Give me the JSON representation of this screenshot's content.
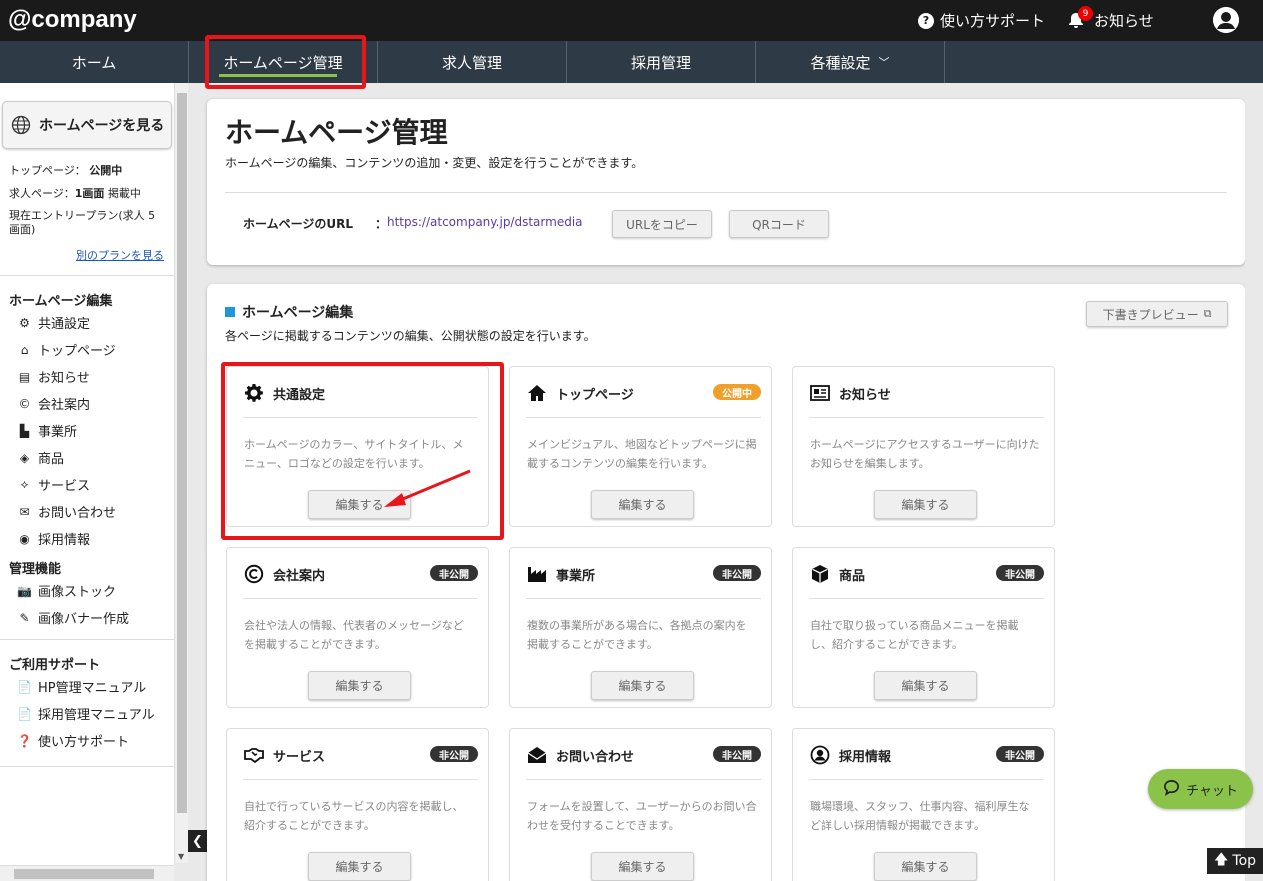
{
  "app": {
    "logo": "@company"
  },
  "header": {
    "help_label": "使い方サポート",
    "notice_label": "お知らせ",
    "notice_count": "9"
  },
  "nav": {
    "items": [
      {
        "label": "ホーム"
      },
      {
        "label": "ホームページ管理",
        "active": true
      },
      {
        "label": "求人管理"
      },
      {
        "label": "採用管理"
      },
      {
        "label": "各種設定",
        "dropdown": true
      }
    ]
  },
  "sidebar": {
    "view_hp_label": "ホームページを見る",
    "plan": {
      "top_label": "トップページ：",
      "top_value": "公開中",
      "job_label": "求人ページ：",
      "job_value": "1画面",
      "job_suffix": " 掲載中",
      "current_plan": "現在エントリープラン(求人 5画面)",
      "other_plan_link": "別のプランを見る"
    },
    "section_edit": "ホームページ編集",
    "edit_items": [
      "共通設定",
      "トップページ",
      "お知らせ",
      "会社案内",
      "事業所",
      "商品",
      "サービス",
      "お問い合わせ",
      "採用情報"
    ],
    "section_admin": "管理機能",
    "admin_items": [
      "画像ストック",
      "画像バナー作成"
    ],
    "section_support": "ご利用サポート",
    "support_items": [
      "HP管理マニュアル",
      "採用管理マニュアル",
      "使い方サポート"
    ]
  },
  "main": {
    "title": "ホームページ管理",
    "description": "ホームページの編集、コンテンツの追加・変更、設定を行うことができます。",
    "url_label": "ホームページのURL",
    "url_colon": "：",
    "url_value": "https://atcompany.jp/dstarmedia",
    "copy_button": "URLをコピー",
    "qr_button": "QRコード"
  },
  "edit_section": {
    "title": "ホームページ編集",
    "description": "各ページに掲載するコンテンツの編集、公開状態の設定を行います。",
    "preview_button": "下書きプレビュー",
    "cards": [
      {
        "icon": "gear-icon",
        "title": "共通設定",
        "badge": "",
        "desc": "ホームページのカラー、サイトタイトル、メニュー、ロゴなどの設定を行います。",
        "button": "編集する"
      },
      {
        "icon": "home-icon",
        "title": "トップページ",
        "badge": "公開中",
        "desc": "メインビジュアル、地図などトップページに掲載するコンテンツの編集を行います。",
        "button": "編集する"
      },
      {
        "icon": "newspaper-icon",
        "title": "お知らせ",
        "badge": "",
        "desc": "ホームページにアクセスするユーザーに向けたお知らせを編集します。",
        "button": "編集する"
      },
      {
        "icon": "copyright-icon",
        "title": "会社案内",
        "badge": "非公開",
        "desc": "会社や法人の情報、代表者のメッセージなどを掲載することができます。",
        "button": "編集する"
      },
      {
        "icon": "factory-icon",
        "title": "事業所",
        "badge": "非公開",
        "desc": "複数の事業所がある場合に、各拠点の案内を掲載することができます。",
        "button": "編集する"
      },
      {
        "icon": "box-icon",
        "title": "商品",
        "badge": "非公開",
        "desc": "自社で取り扱っている商品メニューを掲載し、紹介することができます。",
        "button": "編集する"
      },
      {
        "icon": "handshake-icon",
        "title": "サービス",
        "badge": "非公開",
        "desc": "自社で行っているサービスの内容を掲載し、紹介することができます。",
        "button": "編集する"
      },
      {
        "icon": "envelope-icon",
        "title": "お問い合わせ",
        "badge": "非公開",
        "desc": "フォームを設置して、ユーザーからのお問い合わせを受付することできます。",
        "button": "編集する"
      },
      {
        "icon": "user-circle-icon",
        "title": "採用情報",
        "badge": "非公開",
        "desc": "職場環境、スタッフ、仕事内容、福利厚生など詳しい採用情報が掲載できます。",
        "button": "編集する"
      }
    ]
  },
  "chat": {
    "label": "チャット"
  },
  "back_to_top": {
    "label": "Top"
  },
  "colors": {
    "accent_green": "#8bc34a",
    "highlight_red": "#e8161b",
    "badge_public": "#f0a02a",
    "badge_private": "#333333",
    "nav_bg": "#2e3a46"
  }
}
